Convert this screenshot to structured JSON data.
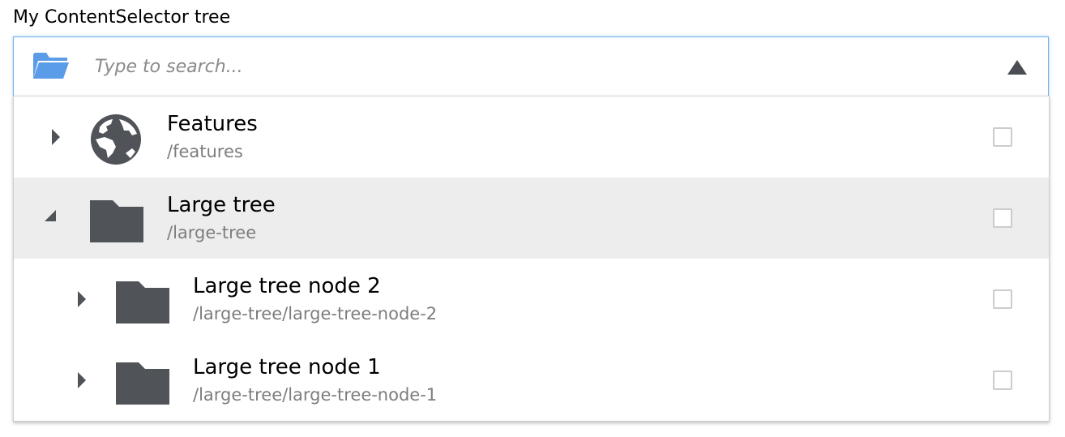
{
  "label": "My ContentSelector tree",
  "search": {
    "placeholder": "Type to search...",
    "value": ""
  },
  "colors": {
    "accent_blue": "#5b9ce8",
    "icon_dark": "#505357",
    "selected_row": "#ededed",
    "path_gray": "#7d7d7d",
    "focus_border": "#6fb0e8"
  },
  "tree": [
    {
      "title": "Features",
      "path": "/features",
      "icon": "globe-icon",
      "expander": "collapsed",
      "level": 0,
      "selected": false,
      "checked": false
    },
    {
      "title": "Large tree",
      "path": "/large-tree",
      "icon": "folder-icon",
      "expander": "expanded",
      "level": 0,
      "selected": true,
      "checked": false
    },
    {
      "title": "Large tree node 2",
      "path": "/large-tree/large-tree-node-2",
      "icon": "folder-icon",
      "expander": "collapsed",
      "level": 1,
      "selected": false,
      "checked": false
    },
    {
      "title": "Large tree node 1",
      "path": "/large-tree/large-tree-node-1",
      "icon": "folder-icon",
      "expander": "collapsed",
      "level": 1,
      "selected": false,
      "checked": false
    }
  ]
}
